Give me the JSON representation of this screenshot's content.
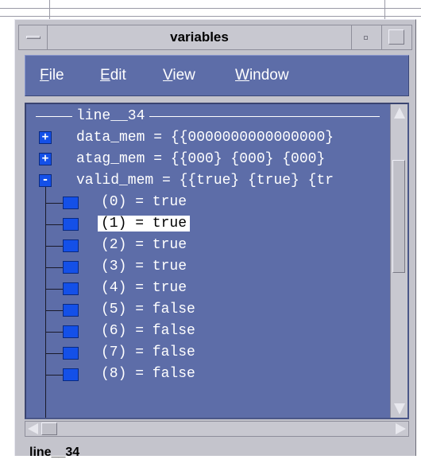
{
  "window": {
    "title": "variables",
    "menu_icon": "window-menu-icon",
    "minimize_icon": "minimize-icon",
    "maximize_icon": "maximize-icon"
  },
  "menubar": {
    "items": [
      {
        "label": "File",
        "mnemonic": "F",
        "rest": "ile"
      },
      {
        "label": "Edit",
        "mnemonic": "E",
        "rest": "dit"
      },
      {
        "label": "View",
        "mnemonic": "V",
        "rest": "iew"
      },
      {
        "label": "Window",
        "mnemonic": "W",
        "rest": "indow"
      }
    ]
  },
  "tree": {
    "group_label": "line__34",
    "nodes": [
      {
        "state": "+",
        "text": "data_mem = {{0000000000000000}"
      },
      {
        "state": "+",
        "text": "atag_mem = {{000} {000} {000}"
      },
      {
        "state": "-",
        "text": "valid_mem = {{true} {true} {tr"
      }
    ],
    "children": [
      {
        "text": "(0) = true",
        "selected": false
      },
      {
        "text": "(1) = true",
        "selected": true
      },
      {
        "text": "(2) = true",
        "selected": false
      },
      {
        "text": "(3) = true",
        "selected": false
      },
      {
        "text": "(4) = true",
        "selected": false
      },
      {
        "text": "(5) = false",
        "selected": false
      },
      {
        "text": "(6) = false",
        "selected": false
      },
      {
        "text": "(7) = false",
        "selected": false
      },
      {
        "text": "(8) = false",
        "selected": false
      }
    ]
  },
  "status": {
    "text": "line__34"
  },
  "colors": {
    "panel_bg": "#5d6da8",
    "node_box": "#1450e8",
    "window_bg": "#c4c4cc"
  }
}
